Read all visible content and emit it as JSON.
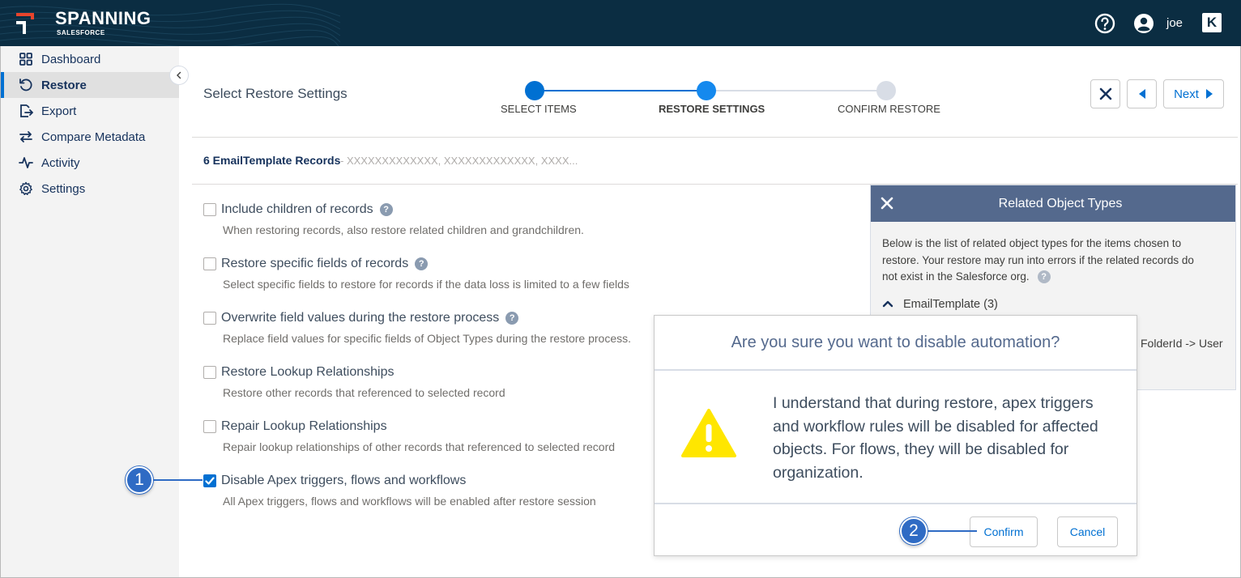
{
  "header": {
    "brand": "SPANNING",
    "brand_sub": "SALESFORCE",
    "user_name": "joe",
    "help_icon": "help-circle-icon",
    "user_icon": "user-avatar-icon",
    "kaseya_icon": "kaseya-logo-icon"
  },
  "sidebar": {
    "items": [
      {
        "label": "Dashboard",
        "icon": "grid-icon"
      },
      {
        "label": "Restore",
        "icon": "restore-icon",
        "active": true
      },
      {
        "label": "Export",
        "icon": "export-icon"
      },
      {
        "label": "Compare Metadata",
        "icon": "compare-icon"
      },
      {
        "label": "Activity",
        "icon": "activity-icon"
      },
      {
        "label": "Settings",
        "icon": "gear-icon"
      }
    ]
  },
  "page": {
    "title": "Select Restore Settings",
    "steps": [
      {
        "label": "SELECT ITEMS",
        "state": "done"
      },
      {
        "label": "RESTORE SETTINGS",
        "state": "current"
      },
      {
        "label": "CONFIRM RESTORE",
        "state": "upcoming"
      }
    ],
    "next_label": "Next",
    "records_title": "6 EmailTemplate Records",
    "records_ids": "- XXXXXXXXXXXXX, XXXXXXXXXXXXX, XXXX..."
  },
  "options": [
    {
      "label": "Include children of records",
      "desc": "When restoring records, also restore related children and grandchildren.",
      "help": true,
      "checked": false
    },
    {
      "label": "Restore specific fields of records",
      "desc": "Select specific fields to restore for records if the data loss is limited to a few fields",
      "help": true,
      "checked": false
    },
    {
      "label": "Overwrite field values during the restore process",
      "desc": "Replace field values for specific fields of Object Types during the restore process.",
      "help": true,
      "checked": false
    },
    {
      "label": "Restore Lookup Relationships",
      "desc": "Restore other records that referenced to selected record",
      "help": false,
      "checked": false
    },
    {
      "label": "Repair Lookup Relationships",
      "desc": "Repair lookup relationships of other records that referenced to selected record",
      "help": false,
      "checked": false
    },
    {
      "label": "Disable Apex triggers, flows and workflows",
      "desc": "All Apex triggers, flows and workflows will be enabled after restore session",
      "help": false,
      "checked": true
    }
  ],
  "help_mark": "?",
  "related": {
    "title": "Related Object Types",
    "description": "Below is the list of related object types for the items chosen to restore. Your restore may run into errors if the related records do not exist in the Salesforce org.",
    "object": "EmailTemplate (3)",
    "relation": "FolderId -> User"
  },
  "modal": {
    "title": "Are you sure you want to disable automation?",
    "message": "I understand that during restore, apex triggers and workflow rules will be disabled for affected objects. For flows, they will be disabled for organization.",
    "confirm_label": "Confirm",
    "cancel_label": "Cancel",
    "icon": "warning-triangle-icon"
  },
  "callouts": [
    "1",
    "2"
  ],
  "colors": {
    "header_bg": "#0b2d42",
    "accent": "#0070d2",
    "panel_head": "#54698d",
    "callout": "#2f6bc4",
    "warning": "#ffe600"
  }
}
